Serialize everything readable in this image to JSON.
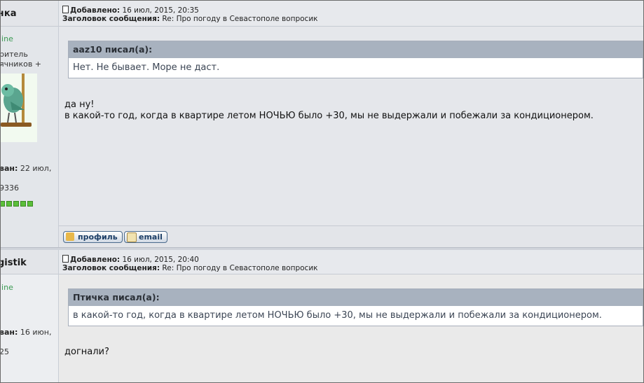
{
  "posts": [
    {
      "author": {
        "name": "чка",
        "status": "line",
        "role_line1": "ритель",
        "role_line2": "ячников +",
        "registered_label": "ван:",
        "registered_value": "22 июл,",
        "count": "9336"
      },
      "header": {
        "added_label": "Добавлено:",
        "added_value": "16 июл, 2015, 20:35",
        "subject_label": "Заголовок сообщения:",
        "subject_value": "Re: Про погоду в Севастополе вопросик"
      },
      "quote": {
        "author_line": "aaz10 писал(а):",
        "text": "Нет. Не бывает. Море не даст."
      },
      "message": {
        "line1": "да ну!",
        "line2": "в какой-то год, когда в квартире летом НОЧЬЮ было +30, мы не выдержали и побежали за кондиционером."
      },
      "buttons": {
        "profile": "профиль",
        "email": "email"
      },
      "rank_squares": 5
    },
    {
      "author": {
        "name": "gistik",
        "status": "line",
        "registered_label": "ван:",
        "registered_value": "16 июн,",
        "count": "25"
      },
      "header": {
        "added_label": "Добавлено:",
        "added_value": "16 июл, 2015, 20:40",
        "subject_label": "Заголовок сообщения:",
        "subject_value": "Re: Про погоду в Севастополе вопросик"
      },
      "quote": {
        "author_line": "Птичка писал(а):",
        "text": "в какой-то год, когда в квартире летом НОЧЬЮ было +30, мы не выдержали и побежали за кондиционером."
      },
      "message": {
        "line1": "догнали?"
      }
    }
  ],
  "colors": {
    "quote_header": "#a8b2bf",
    "online": "#3a9a52",
    "rank": "#5bbf3a"
  }
}
